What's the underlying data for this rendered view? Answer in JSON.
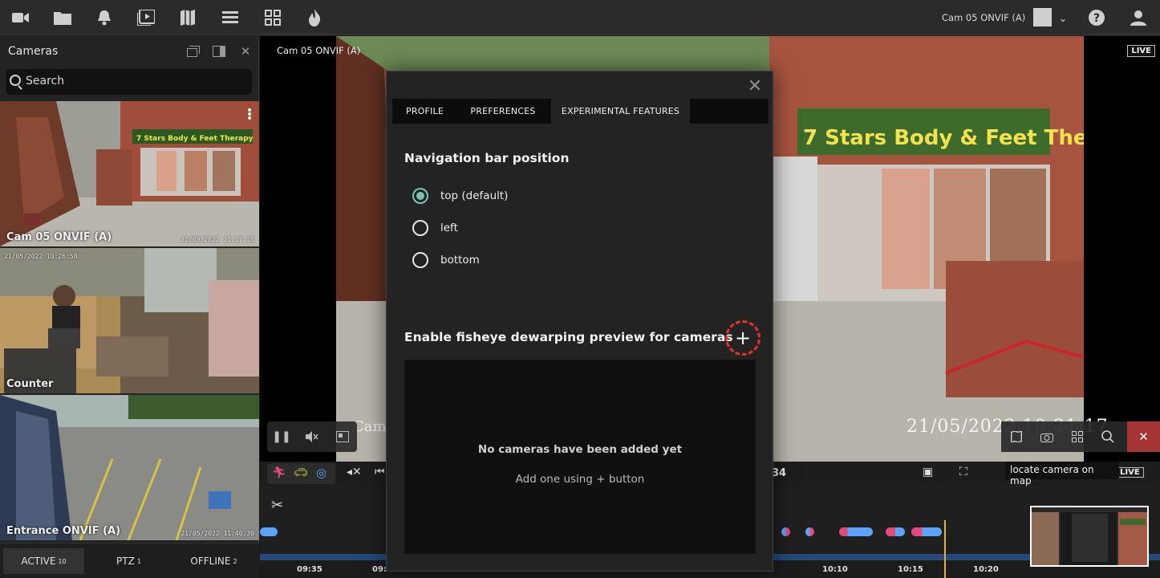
{
  "topbar": {
    "icons": [
      "video-camera-icon",
      "folder-icon",
      "bell-icon",
      "playback-icon",
      "map-icon",
      "list-icon",
      "grid-icon",
      "fire-icon"
    ],
    "camera_title": "Cam 05 ONVIF (A)"
  },
  "sidebar": {
    "title": "Cameras",
    "search_placeholder": "Search",
    "cameras": [
      {
        "name": "Cam 05 ONVIF (A)",
        "timestamp": "21/05/2022 11:17:10"
      },
      {
        "name": "Counter",
        "timestamp": "21/05/2022 10:26:58"
      },
      {
        "name": "Entrance ONVIF (A)",
        "timestamp": "21/05/2022 11:40:30"
      }
    ],
    "tabs": [
      {
        "label": "ACTIVE",
        "count": "10"
      },
      {
        "label": "PTZ",
        "count": "1"
      },
      {
        "label": "OFFLINE",
        "count": "2"
      }
    ]
  },
  "video": {
    "title": "Cam 05 ONVIF (A)",
    "live": "LIVE",
    "osd_timestamp": "21/05/2022 10:21:17",
    "osd_cam": "Cam",
    "sign_text": "7 Stars Body & Feet Therapy",
    "tooltip": "locate camera on map",
    "timeline_live": "LIVE",
    "time_readout": "34"
  },
  "timeline": {
    "ticks": [
      "09:35",
      "09:",
      "10:10",
      "10:15",
      "10:20"
    ]
  },
  "modal": {
    "tabs": [
      "PROFILE",
      "PREFERENCES",
      "EXPERIMENTAL FEATURES"
    ],
    "active_tab": "EXPERIMENTAL FEATURES",
    "nav_title": "Navigation bar position",
    "nav_options": [
      "top (default)",
      "left",
      "bottom"
    ],
    "nav_selected": "top (default)",
    "fisheye_title": "Enable fisheye dewarping preview for cameras",
    "add_label": "+",
    "empty_title": "No cameras have been added yet",
    "empty_sub": "Add one using + button"
  },
  "colors": {
    "accent_radio": "#7fc3b5",
    "close_red": "#a53535",
    "highlight_ring": "#e0322a",
    "timeline_blue": "#254a7a",
    "playhead": "#e2b33c"
  }
}
